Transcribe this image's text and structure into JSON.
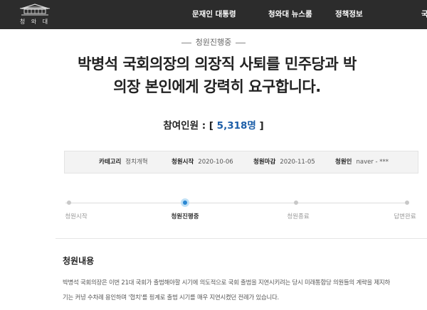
{
  "header": {
    "logo_text": "청 와 대",
    "nav": [
      "문재인 대통령",
      "청와대 뉴스룸",
      "정책정보",
      "국"
    ]
  },
  "petition": {
    "status": "청원진행중",
    "title_lines": [
      "박병석 국회의장의 의장직 사퇴를 민주당과 박",
      "의장 본인에게 강력히 요구합니다."
    ],
    "participants_label": "참여인원 : [",
    "participants_count": "5,318명",
    "participants_close": "]",
    "info": [
      {
        "label": "카테고리",
        "value": "정치개혁"
      },
      {
        "label": "청원시작",
        "value": "2020-10-06"
      },
      {
        "label": "청원마감",
        "value": "2020-11-05"
      },
      {
        "label": "청원인",
        "value": "naver - ***"
      }
    ],
    "steps": [
      {
        "label": "청원시작",
        "active": false
      },
      {
        "label": "청원진행중",
        "active": true
      },
      {
        "label": "청원종료",
        "active": false
      },
      {
        "label": "답변완료",
        "active": false
      }
    ],
    "content_heading": "청원내용",
    "content_lines": [
      "박병석 국회의장은 이번 21대 국회가 출범해야할 시기에 의도적으로 국회 출범을 지연시키려는 당시 미래통합당 의원들의 계략을 제지하",
      "기는 커녕 수차례 용인하며 '협치'를 핑계로 출범 시기를 매우 지연시켰던 전례가 있습니다."
    ]
  }
}
